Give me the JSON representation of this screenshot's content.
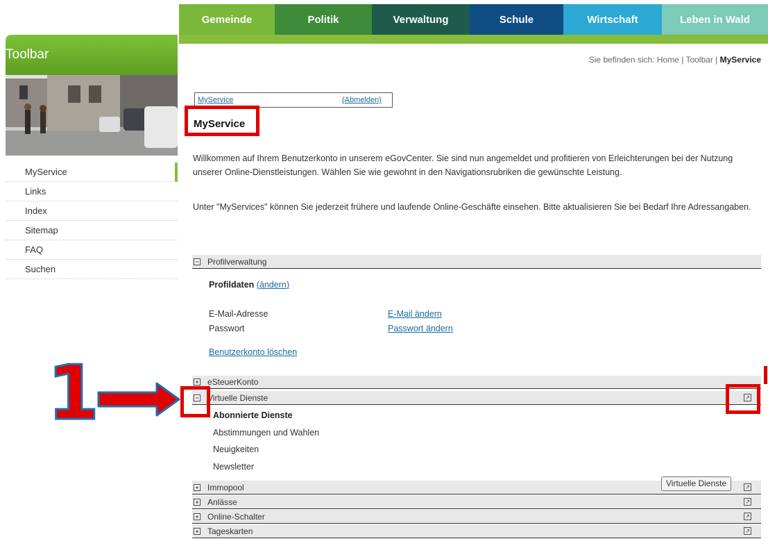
{
  "topnav": {
    "tabs": [
      {
        "label": "Gemeinde",
        "color": "#7ab73a"
      },
      {
        "label": "Politik",
        "color": "#3e8c3a"
      },
      {
        "label": "Verwaltung",
        "color": "#1e5b4a"
      },
      {
        "label": "Schule",
        "color": "#0f4d84"
      },
      {
        "label": "Wirtschaft",
        "color": "#2ba8d3"
      },
      {
        "label": "Leben in Wald",
        "color": "#7ccab8"
      }
    ]
  },
  "sidebar": {
    "title": "Toolbar",
    "items": [
      {
        "label": "MyService",
        "active": true
      },
      {
        "label": "Links"
      },
      {
        "label": "Index"
      },
      {
        "label": "Sitemap"
      },
      {
        "label": "FAQ"
      },
      {
        "label": "Suchen"
      }
    ]
  },
  "breadcrumb": {
    "prefix": "Sie befinden sich:",
    "home": "Home",
    "sep": "|",
    "toolbar": "Toolbar",
    "current": "MyService"
  },
  "login": {
    "user_link": "MyService",
    "logout_link": "(Abmelden)"
  },
  "page": {
    "title": "MyService",
    "intro": "Willkommen auf Ihrem Benutzerkonto in unserem eGovCenter. Sie sind nun angemeldet und profitieren von Erleichterungen bei der Nutzung unserer Online-Dienstleistungen. Wählen Sie wie gewohnt in den Navigationsrubriken die gewünschte Leistung.",
    "info": "Unter \"MyServices\" können Sie jederzeit frühere und laufende Online-Geschäfte einsehen. Bitte aktualisieren Sie bei Bedarf Ihre Adressangaben."
  },
  "profile": {
    "section_label": "Profilverwaltung",
    "heading": "Profildaten",
    "edit_link": "ändern",
    "email_label": "E-Mail-Adresse",
    "email_link": "E-Mail ändern",
    "password_label": "Passwort",
    "password_link": "Passwort ändern",
    "delete_link": "Benutzerkonto löschen"
  },
  "sections": {
    "esteuer": "eSteuerKonto",
    "virtual": "Virtuelle Dienste",
    "virtual_heading": "Abonnierte Dienste",
    "virtual_items": [
      "Abstimmungen und Wahlen",
      "Neuigkeiten",
      "Newsletter"
    ],
    "immopool": "Immopool",
    "anlaesse": "Anlässe",
    "schalter": "Online-Schalter",
    "tageskarten": "Tageskarten"
  },
  "tooltip": "Virtuelle Dienste",
  "annotation": {
    "number": "1"
  },
  "icons": {
    "collapse": "minus-box-icon",
    "expand": "plus-box-icon",
    "external": "external-link-icon",
    "arrow": "red-arrow-icon"
  }
}
